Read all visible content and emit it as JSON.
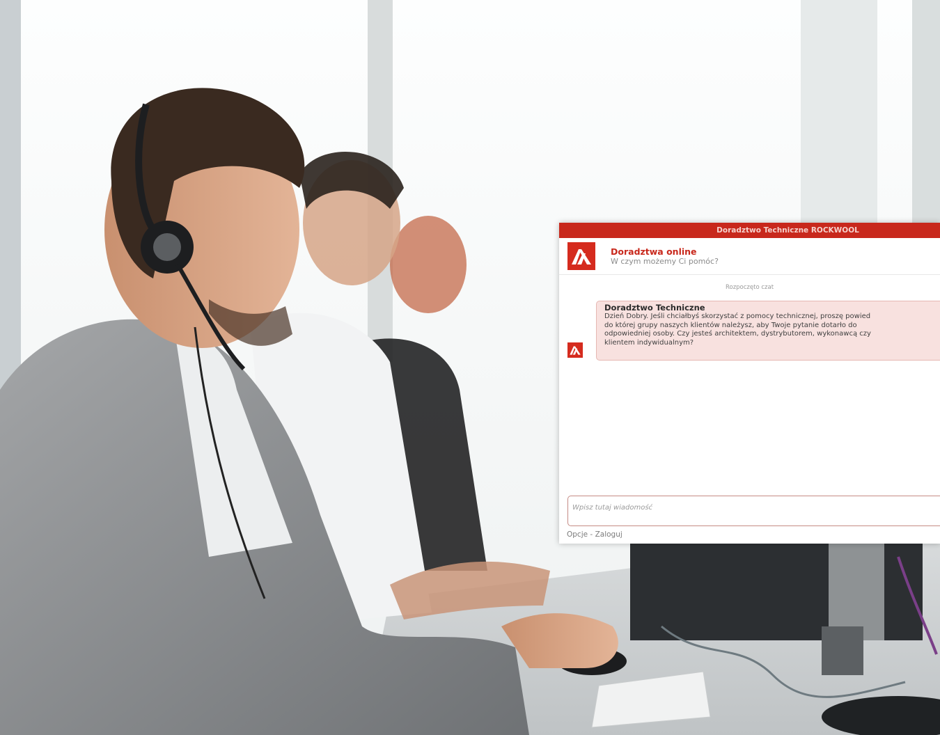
{
  "chat": {
    "title_bar": "Doradztwo Techniczne ROCKWOOL",
    "header_title": "Doradztwa online",
    "header_subtitle": "W czym możemy Ci pomóc?",
    "status_started": "Rozpoczęto czat",
    "message": {
      "sender": "Doradztwo Techniczne",
      "lines": [
        "Dzień Dobry. Jeśli chciałbyś skorzystać z  pomocy technicznej, proszę powied",
        "do której grupy naszych klientów należysz, aby Twoje pytanie dotarło do",
        "odpowiedniej osoby. Czy jesteś architektem, dystrybutorem, wykonawcą czy",
        "klientem indywidualnym?"
      ]
    },
    "input_placeholder": "Wpisz tutaj wiadomość",
    "footer": {
      "options": "Opcje",
      "separator": " - ",
      "login": "Zaloguj"
    }
  },
  "colors": {
    "brand_red": "#d52b1e",
    "title_bar": "#c8281c",
    "bubble_bg": "#f8e1df"
  }
}
